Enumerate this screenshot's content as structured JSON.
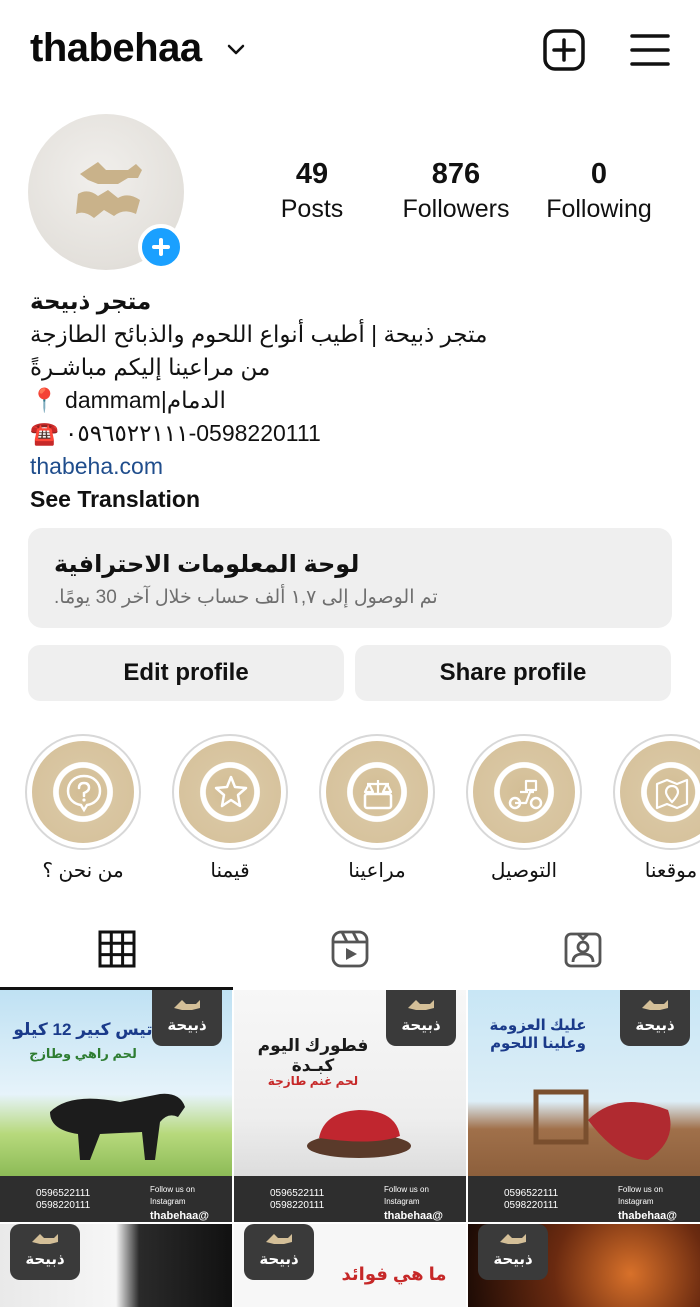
{
  "header": {
    "username": "thabehaa"
  },
  "profile": {
    "stats": [
      {
        "value": "49",
        "label": "Posts"
      },
      {
        "value": "876",
        "label": "Followers"
      },
      {
        "value": "0",
        "label": "Following"
      }
    ]
  },
  "bio": {
    "name": "متجر ذبيحة",
    "line1": "متجر ذبيحة | أطيب أنواع اللحوم والذبائح الطازجة",
    "line2": "من مراعينا إليكم مباشـرةً",
    "location": "📍 dammam|الدمام",
    "phones": "☎️ ٠٥٩٦٥٢٢١١١-0598220111",
    "link": "thabeha.com",
    "see_translation": "See Translation"
  },
  "dashboard": {
    "title": "لوحة المعلومات الاحترافية",
    "subtitle": "تم الوصول إلى ١,٧ ألف حساب خلال آخر 30 يومًا."
  },
  "buttons": {
    "edit": "Edit profile",
    "share": "Share profile"
  },
  "highlights": [
    {
      "label": "من نحن ؟",
      "icon": "question-bubble-icon"
    },
    {
      "label": "قيمنا",
      "icon": "star-badge-icon"
    },
    {
      "label": "مراعينا",
      "icon": "scale-icon"
    },
    {
      "label": "التوصيل",
      "icon": "delivery-scooter-icon"
    },
    {
      "label": "موقعنا",
      "icon": "map-pin-icon"
    }
  ],
  "tabs": [
    {
      "name": "grid-icon",
      "active": true
    },
    {
      "name": "reels-icon",
      "active": false
    },
    {
      "name": "tagged-icon",
      "active": false
    }
  ],
  "posts": [
    {
      "title": "تيس كبير 12 كيلو",
      "subtitle": "لحم راهي وطازج",
      "badge": "ذبيحة",
      "phone1": "0596522111",
      "phone2": "0598220111",
      "handle": "thabehaa@",
      "follow": "Follow us on Instagram"
    },
    {
      "title": "فطورك اليوم كبـدة",
      "subtitle": "لحم غنم طازجة",
      "badge": "ذبيحة",
      "phone1": "0596522111",
      "phone2": "0598220111",
      "handle": "thabehaa@",
      "follow": "Follow us on Instagram"
    },
    {
      "title": "عليك العزومة وعلينا اللحوم",
      "subtitle": "",
      "badge": "ذبيحة",
      "phone1": "0596522111",
      "phone2": "0598220111",
      "handle": "thabehaa@",
      "follow": "Follow us on Instagram"
    },
    {
      "title": "",
      "subtitle": "",
      "badge": "ذبيحة"
    },
    {
      "title": "ما هي فوائد",
      "subtitle": "",
      "badge": "ذبيحة"
    },
    {
      "title": "",
      "subtitle": "",
      "badge": "ذبيحة"
    }
  ],
  "colors": {
    "accent_blue": "#1aa0ff",
    "link": "#1f4d8c",
    "gold": "#d4bf98",
    "card_bg": "#efefef"
  }
}
